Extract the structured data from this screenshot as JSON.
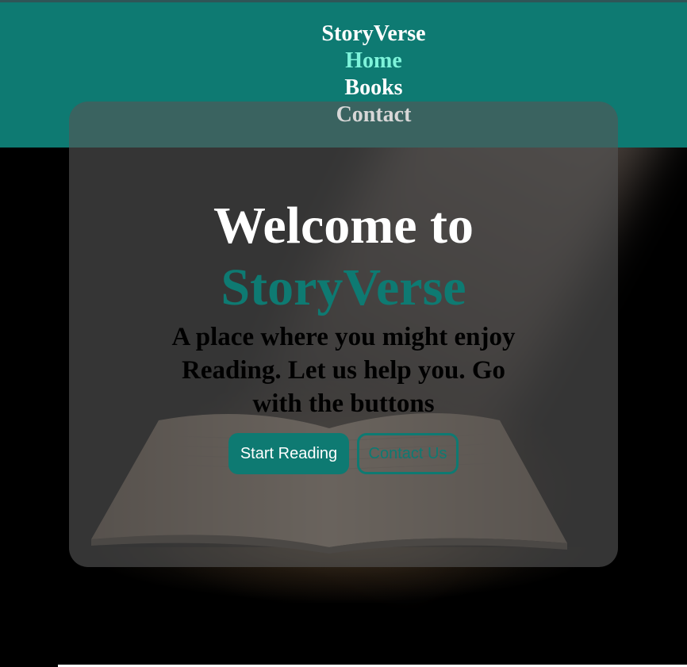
{
  "nav": {
    "brand": "StoryVerse",
    "items": [
      {
        "label": "Home"
      },
      {
        "label": "Books"
      },
      {
        "label": "Contact"
      }
    ]
  },
  "hero": {
    "heading_prefix": "Welcome to",
    "heading_brand": "StoryVerse",
    "tagline": "A place where you might enjoy Reading. Let us help you. Go with the buttons",
    "primary_button": "Start Reading",
    "secondary_button": "Contact Us"
  },
  "colors": {
    "header_bg": "#0e7a72",
    "accent": "#0e7a72",
    "active_nav": "#7ef3da",
    "card_bg": "rgba(85,85,85,0.62)"
  },
  "icons": {
    "background": "open-book-image"
  }
}
